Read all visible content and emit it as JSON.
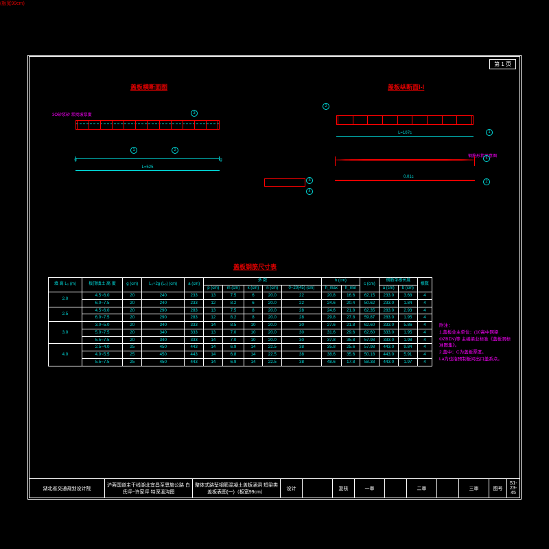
{
  "page_tag": "第 1 页",
  "titles": {
    "left": "盖板横断面图",
    "right": "盖板纵断面Ⅰ-Ⅰ",
    "table": "盖板钢筋尺寸表",
    "units": "(板宽99cm)",
    "curve_label": "钢筋形状示意图"
  },
  "mortar_label": "3O砂浆砂\n浆找坡厚度",
  "dims": {
    "main_len": "L=525",
    "right_len": "L=107c",
    "center_mid": "0.01c"
  },
  "bubbles": {
    "one": "1",
    "two": "2",
    "three": "3",
    "four": "4"
  },
  "notes": {
    "header": "附注：",
    "n1": "1.盖板业主单位：(10高中网梁 ΦΖΒΣΝ)等\n  主编梁业标准《盖板洞标准图集》。",
    "n2": "2.盖中：C为盖板厚度。",
    "n3": "La为也指预制板间出口盖系点。"
  },
  "table": {
    "head_group": [
      "填\n高\nL₀\n(m)",
      "板顶填土\n高  度\n",
      "g\n(cm)",
      "L₀+2g\n(L₀)\n(cm)",
      "a\n(cm)",
      "p\n(cm)",
      "多 数",
      "",
      "",
      "",
      "h  (cm)",
      "",
      "",
      "钢筋单根长度",
      "",
      "",
      ""
    ],
    "head2": [
      "",
      "",
      "",
      "",
      "",
      "",
      "m\n(cm)",
      "k\n(cm)",
      "n\n(cm)",
      "0~20(45)\n(cm)",
      "h_max",
      "h_min",
      "c\n(cm)",
      "a\n(cm)",
      "b\n(cm)",
      "根数"
    ],
    "rows": [
      [
        "2.0",
        "4.5~6.0",
        "20",
        "240",
        "233",
        "13",
        "7.5",
        "6",
        "20.0",
        "22",
        "20.8",
        "16.6",
        "62.15",
        "233.0",
        "3.68",
        "4"
      ],
      [
        "",
        "6.0~7.5",
        "20",
        "240",
        "233",
        "12",
        "8.2",
        "6",
        "20.0",
        "22",
        "24.6",
        "20.4",
        "50.62",
        "233.0",
        "1.84",
        "4"
      ],
      [
        "2.5",
        "4.5~6.0",
        "20",
        "290",
        "283",
        "13",
        "7.5",
        "8",
        "20.0",
        "28",
        "24.6",
        "21.8",
        "62.35",
        "283.0",
        "2.93",
        "4"
      ],
      [
        "",
        "6.0~7.5",
        "20",
        "290",
        "283",
        "12",
        "8.2",
        "8",
        "20.0",
        "28",
        "29.8",
        "27.8",
        "59.87",
        "283.0",
        "1.95",
        "4"
      ],
      [
        "3.0",
        "3.0~5.0",
        "20",
        "340",
        "333",
        "14",
        "8.5",
        "10",
        "20.0",
        "30",
        "27.6",
        "21.8",
        "62.60",
        "333.0",
        "5.86",
        "4"
      ],
      [
        "",
        "5.0~7.5",
        "20",
        "340",
        "333",
        "13",
        "7.0",
        "10",
        "20.0",
        "30",
        "31.6",
        "29.6",
        "62.60",
        "333.0",
        "1.95",
        "4"
      ],
      [
        "",
        "5.5~7.5",
        "20",
        "340",
        "333",
        "14",
        "7.0",
        "10",
        "20.0",
        "30",
        "37.8",
        "35.8",
        "57.98",
        "333.0",
        "1.98",
        "4"
      ],
      [
        "4.0",
        "2.5~4.0",
        "25",
        "450",
        "443",
        "14",
        "6.9",
        "14",
        "22.5",
        "38",
        "35.8",
        "25.6",
        "57.98",
        "443.0",
        "9.84",
        "4"
      ],
      [
        "",
        "4.0~5.5",
        "25",
        "450",
        "443",
        "14",
        "6.8",
        "14",
        "22.5",
        "38",
        "38.6",
        "35.6",
        "50.18",
        "443.0",
        "5.91",
        "4"
      ],
      [
        "",
        "5.5~7.5",
        "25",
        "450",
        "443",
        "14",
        "6.9",
        "14",
        "22.5",
        "38",
        "48.6",
        "17.8",
        "58.38",
        "443.0",
        "1.97",
        "4"
      ]
    ]
  },
  "titleblock": {
    "org": "湖北省交通规划设计院",
    "proj": "沪蓉国道主干线湖北宜昌至恩施公路\n白氏坪~许家坪  特深溪沟图",
    "sheet": "整体式路堑钢筋混凝土盖板涵洞\n短梁类盖板表图(一)（板宽99cm）",
    "c1": "设计",
    "c2": "复核",
    "c3": "一审",
    "c4": "二审",
    "c5": "三审",
    "num_lbl": "图号",
    "num": "S1-23-45"
  }
}
